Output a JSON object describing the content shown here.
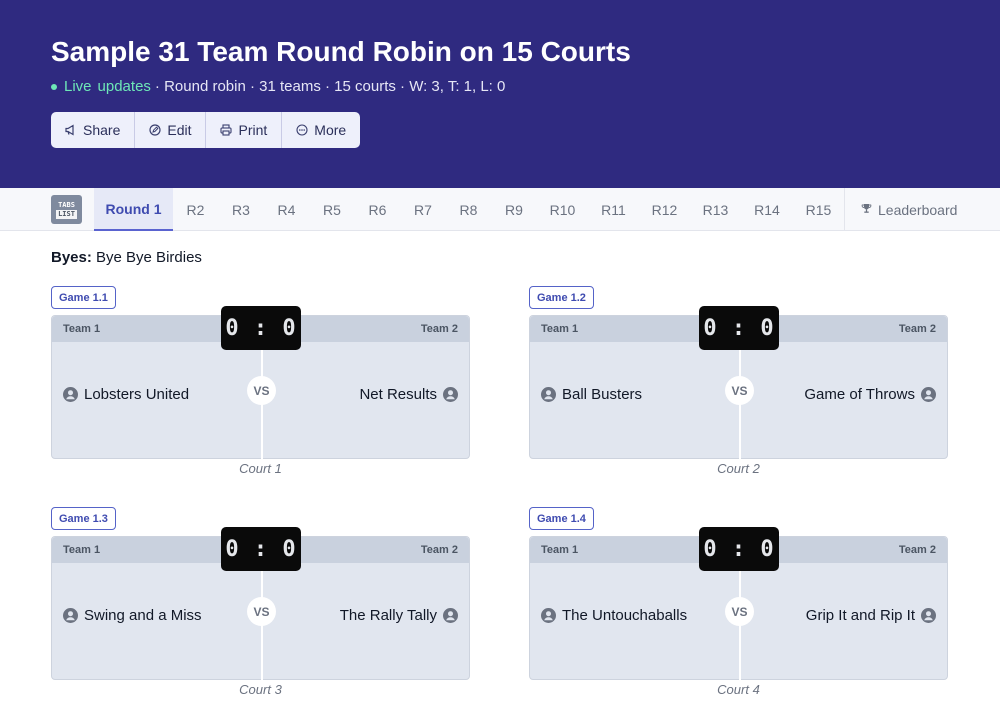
{
  "header": {
    "title": "Sample 31 Team Round Robin on 15 Courts",
    "live_label": "Live",
    "updates_label": "updates",
    "meta": "· Round robin · 31 teams · 15 courts · W: 3, T: 1, L: 0",
    "actions": [
      {
        "label": "Share",
        "icon": "megaphone-icon"
      },
      {
        "label": "Edit",
        "icon": "edit-icon"
      },
      {
        "label": "Print",
        "icon": "printer-icon"
      },
      {
        "label": "More",
        "icon": "more-icon"
      }
    ]
  },
  "tabs": {
    "logo_line1": "TABS",
    "logo_line2": "LIST",
    "rounds": [
      "Round 1",
      "R2",
      "R3",
      "R4",
      "R5",
      "R6",
      "R7",
      "R8",
      "R9",
      "R10",
      "R11",
      "R12",
      "R13",
      "R14",
      "R15"
    ],
    "active": "Round 1",
    "leaderboard": "Leaderboard"
  },
  "byes": {
    "label": "Byes:",
    "teams": "Bye Bye Birdies"
  },
  "games": [
    {
      "label": "Game 1.1",
      "team1_label": "Team 1",
      "team2_label": "Team 2",
      "score": "0 : 0",
      "vs": "VS",
      "team1": "Lobsters United",
      "team2": "Net Results",
      "court": "Court 1"
    },
    {
      "label": "Game 1.2",
      "team1_label": "Team 1",
      "team2_label": "Team 2",
      "score": "0 : 0",
      "vs": "VS",
      "team1": "Ball Busters",
      "team2": "Game of Throws",
      "court": "Court 2"
    },
    {
      "label": "Game 1.3",
      "team1_label": "Team 1",
      "team2_label": "Team 2",
      "score": "0 : 0",
      "vs": "VS",
      "team1": "Swing and a Miss",
      "team2": "The Rally Tally",
      "court": "Court 3"
    },
    {
      "label": "Game 1.4",
      "team1_label": "Team 1",
      "team2_label": "Team 2",
      "score": "0 : 0",
      "vs": "VS",
      "team1": "The Untouchaballs",
      "team2": "Grip It and Rip It",
      "court": "Court 4"
    }
  ],
  "colors": {
    "header_bg": "#2f2a80",
    "live": "#6ee7b7",
    "accent": "#3f4bb0",
    "card_bg": "#e1e6ef"
  }
}
